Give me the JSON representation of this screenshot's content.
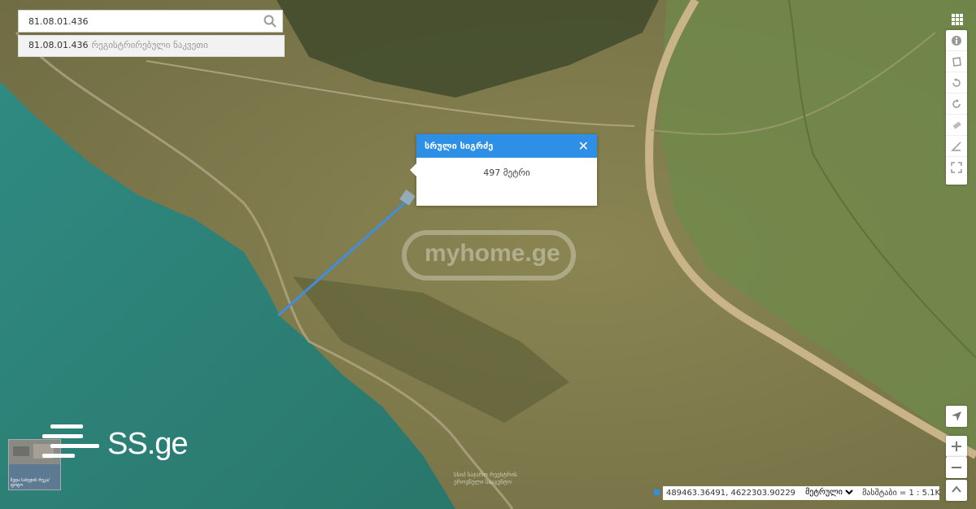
{
  "search": {
    "value": "81.08.01.436",
    "suggestion_code": "81.08.01.436",
    "suggestion_label": "რეგისტრირებული ნაკვეთი"
  },
  "popup": {
    "title": "სრული სიგრძე",
    "value": "497 მეტრი"
  },
  "watermark": "myhome.ge",
  "logo": "SS.ge",
  "statusbar": {
    "coords": "489463.36491, 4622303.90229",
    "unit": "მეტრული",
    "scale": "მასშტაბი = 1 : 5.1K"
  },
  "minimap": {
    "label": "ზედა სახედის რუკა/ფოტო"
  },
  "attribution": [
    "სსიპ საჯარო რეესტრის",
    "ეროვნული სააგენტო"
  ],
  "colors": {
    "accent": "#2d8fe6",
    "water": "#2c7f75",
    "land": "#7d7a4e",
    "road": "#c9b48a"
  },
  "toolbar_icons": [
    "layers-icon",
    "info-icon",
    "polygon-icon",
    "rotate-left-icon",
    "rotate-right-icon",
    "eraser-icon",
    "angle-icon",
    "fullscreen-icon",
    "locate-icon",
    "zoom-in-icon",
    "zoom-out-icon",
    "north-icon"
  ]
}
